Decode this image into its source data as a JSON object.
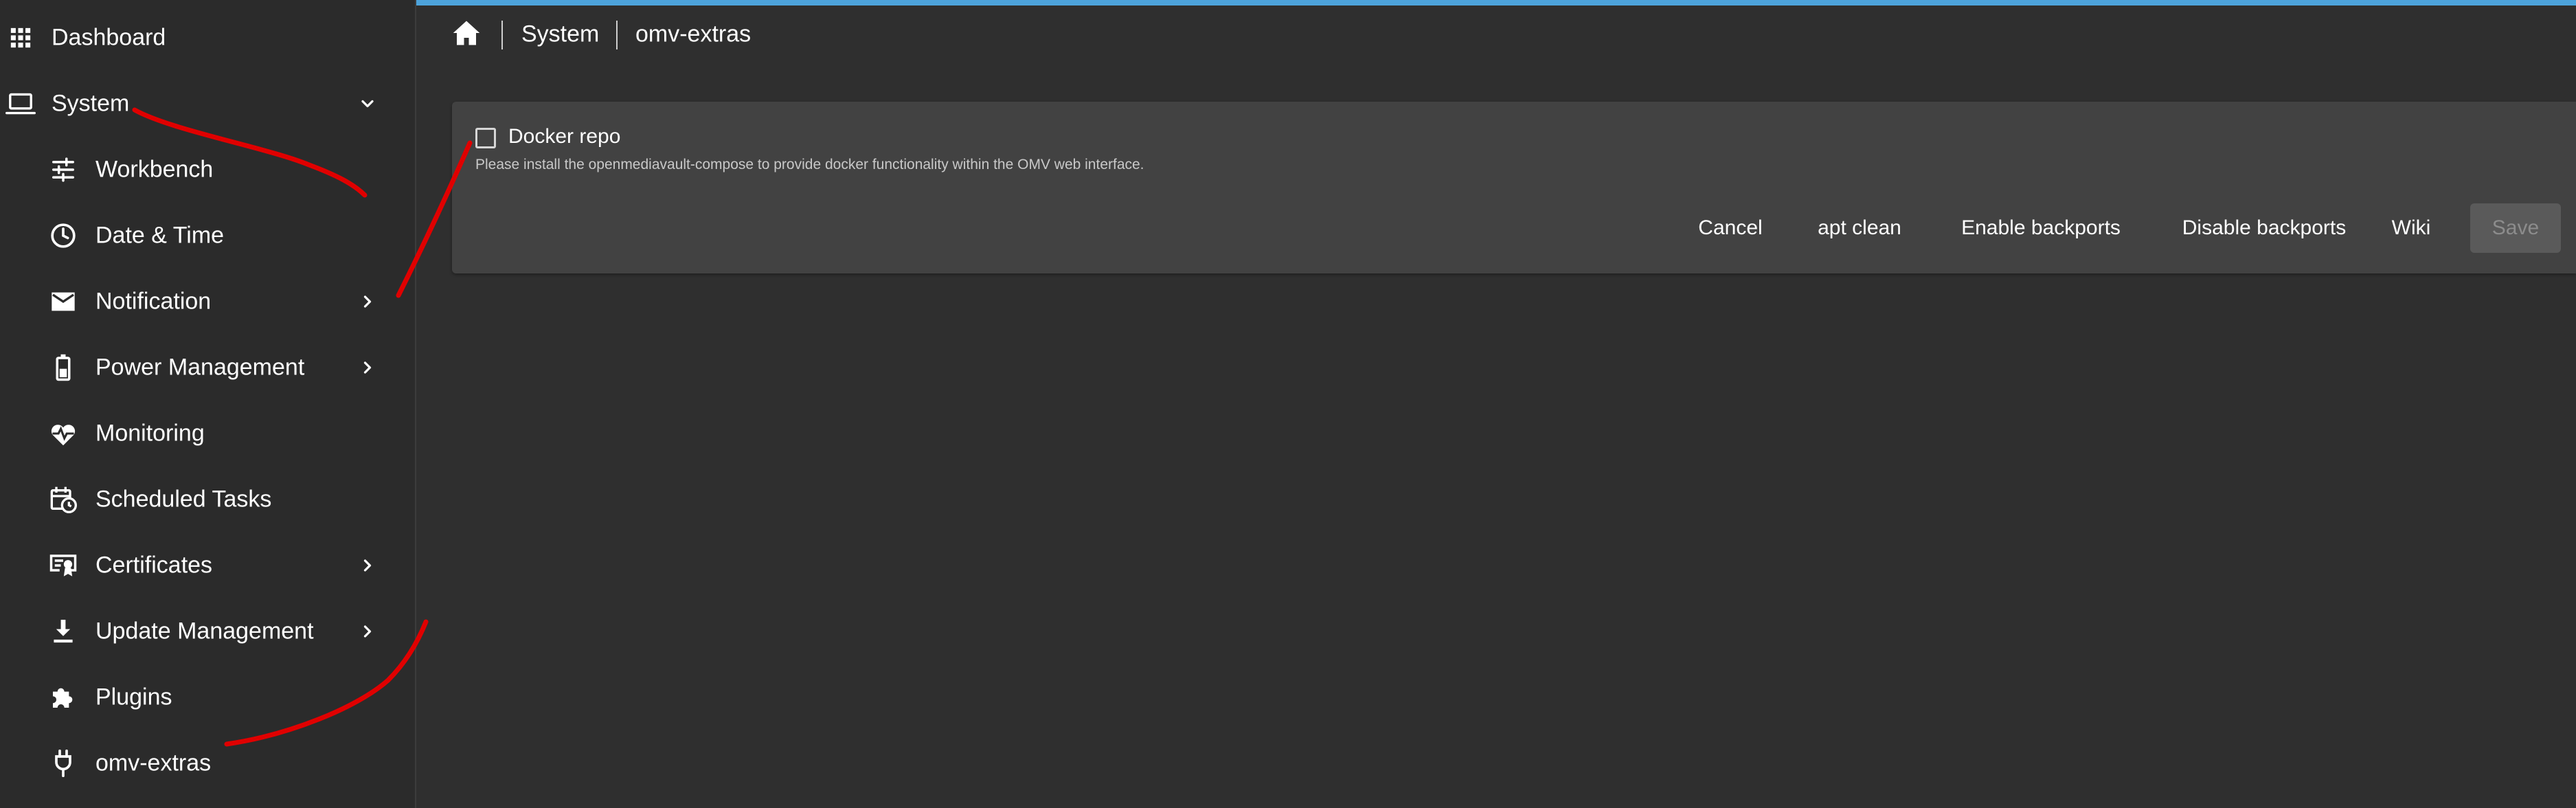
{
  "sidebar": {
    "items": [
      {
        "label": "Dashboard",
        "icon": "apps-grid-icon",
        "level": "top",
        "expandable": false
      },
      {
        "label": "System",
        "icon": "laptop-icon",
        "level": "top",
        "expandable": true,
        "expanded": true
      },
      {
        "label": "Workbench",
        "icon": "tune-icon",
        "level": "sub",
        "expandable": false
      },
      {
        "label": "Date & Time",
        "icon": "clock-icon",
        "level": "sub",
        "expandable": false
      },
      {
        "label": "Notification",
        "icon": "mail-icon",
        "level": "sub",
        "expandable": true
      },
      {
        "label": "Power Management",
        "icon": "battery-icon",
        "level": "sub",
        "expandable": true
      },
      {
        "label": "Monitoring",
        "icon": "heart-pulse-icon",
        "level": "sub",
        "expandable": false
      },
      {
        "label": "Scheduled Tasks",
        "icon": "calendar-clock-icon",
        "level": "sub",
        "expandable": false
      },
      {
        "label": "Certificates",
        "icon": "certificate-icon",
        "level": "sub",
        "expandable": true
      },
      {
        "label": "Update Management",
        "icon": "download-icon",
        "level": "sub",
        "expandable": true
      },
      {
        "label": "Plugins",
        "icon": "puzzle-icon",
        "level": "sub",
        "expandable": false
      },
      {
        "label": "omv-extras",
        "icon": "plug-icon",
        "level": "sub",
        "expandable": false
      }
    ]
  },
  "breadcrumb": {
    "home_icon": "home-icon",
    "items": [
      "System",
      "omv-extras"
    ]
  },
  "form": {
    "checkbox_label": "Docker repo",
    "checkbox_checked": false,
    "hint": "Please install the openmediavault-compose to provide docker functionality within the OMV web interface."
  },
  "buttons": {
    "cancel": "Cancel",
    "apt_clean": "apt clean",
    "enable_backports": "Enable backports",
    "disable_backports": "Disable backports",
    "wiki": "Wiki",
    "save": "Save"
  },
  "colors": {
    "accent": "#4da3db",
    "sidebar_bg": "#2b2b2b",
    "content_bg": "#2f2f2f",
    "card_bg": "#424242",
    "annotation": "#e00000"
  }
}
